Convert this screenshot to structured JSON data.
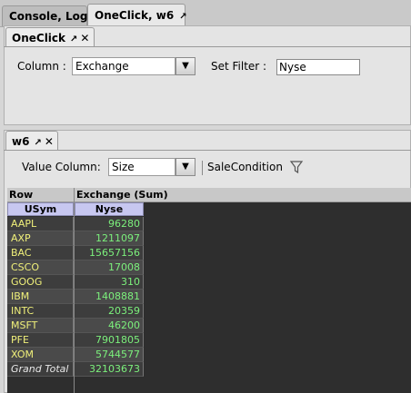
{
  "top_tabs": [
    {
      "label": "Console, Log"
    },
    {
      "label": "OneClick, w6",
      "icon": "pin-icon"
    }
  ],
  "oneclick_panel": {
    "tab_label": "OneClick",
    "column_label": "Column :",
    "column_value": "Exchange",
    "filter_label": "Set Filter :",
    "filter_value": "Nyse"
  },
  "w6_panel": {
    "tab_label": "w6",
    "value_column_label": "Value Column:",
    "value_column_value": "Size",
    "sale_condition_label": "SaleCondition"
  },
  "grid": {
    "row_header": "Row",
    "group_header": "Exchange (Sum)",
    "row_col_header": "USym",
    "value_col_header": "Nyse",
    "rows": [
      {
        "sym": "AAPL",
        "value": "96280"
      },
      {
        "sym": "AXP",
        "value": "1211097"
      },
      {
        "sym": "BAC",
        "value": "15657156"
      },
      {
        "sym": "CSCO",
        "value": "17008"
      },
      {
        "sym": "GOOG",
        "value": "310"
      },
      {
        "sym": "IBM",
        "value": "1408881"
      },
      {
        "sym": "INTC",
        "value": "20359"
      },
      {
        "sym": "MSFT",
        "value": "46200"
      },
      {
        "sym": "PFE",
        "value": "7901805"
      },
      {
        "sym": "XOM",
        "value": "5744577"
      }
    ],
    "total_label": "Grand Total",
    "total_value": "32103673"
  },
  "colors": {
    "grid_bg": "#2e2e2e",
    "row_label": "#f0f07a",
    "value": "#7cf07c",
    "col_header": "#c7c7f0"
  }
}
